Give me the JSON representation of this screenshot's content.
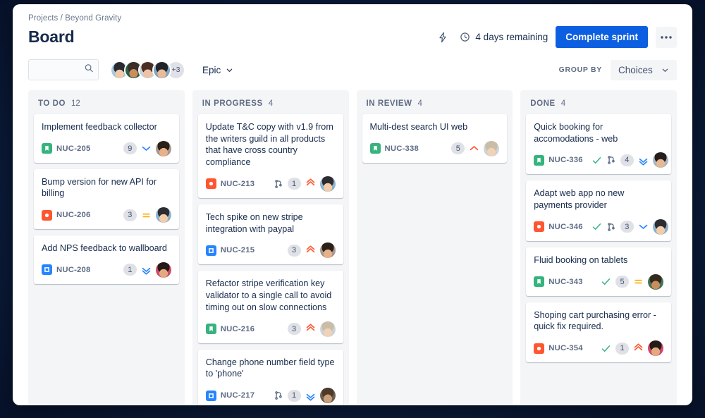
{
  "header": {
    "breadcrumb": "Projects / Beyond Gravity",
    "title": "Board",
    "lightning_icon": "lightning-icon",
    "clock_icon": "clock-icon",
    "days_remaining": "4 days remaining",
    "complete_sprint_label": "Complete sprint",
    "more_label": "•••"
  },
  "toolbar": {
    "search_placeholder": "",
    "search_value": "",
    "search_icon": "search-icon",
    "avatar_overflow": "+3",
    "avatar_count": 4,
    "epic_label": "Epic",
    "epic_chevron": "chevron-down-icon",
    "group_by_label": "GROUP BY",
    "group_by_value": "Choices",
    "group_by_chevron": "chevron-down-icon"
  },
  "colors": {
    "accent": "#0c5fe0",
    "story": "#36b37e",
    "bug": "#ff5630",
    "task": "#2684ff",
    "column_bg": "#f4f5f7",
    "text": "#172b4d",
    "subtle_text": "#5e6c84",
    "priority_high": "#ff5630",
    "priority_medium": "#ffab00",
    "priority_low": "#2684ff",
    "done": "#36b37e",
    "page_bg": "#0b1b3a"
  },
  "columns": [
    {
      "name": "TO DO",
      "count": "12",
      "cards": [
        {
          "title": "Implement feedback collector",
          "key": "NUC-205",
          "type": "story",
          "estimate": "9",
          "priority": "low",
          "branch": false,
          "done": false,
          "avatar": 5
        },
        {
          "title": "Bump version for new API for billing",
          "key": "NUC-206",
          "type": "bug",
          "estimate": "3",
          "priority": "medium",
          "branch": false,
          "done": false,
          "avatar": 0
        },
        {
          "title": "Add NPS feedback to wallboard",
          "key": "NUC-208",
          "type": "task",
          "estimate": "1",
          "priority": "lowest",
          "branch": false,
          "done": false,
          "avatar": 6
        }
      ]
    },
    {
      "name": "IN PROGRESS",
      "count": "4",
      "cards": [
        {
          "title": "Update T&C copy with v1.9 from the writers guild in all products that have cross country compliance",
          "key": "NUC-213",
          "type": "bug",
          "estimate": "1",
          "priority": "highest",
          "branch": true,
          "done": false,
          "avatar": 0
        },
        {
          "title": "Tech spike on new stripe integration with paypal",
          "key": "NUC-215",
          "type": "task",
          "estimate": "3",
          "priority": "highest",
          "branch": false,
          "done": false,
          "avatar": 5
        },
        {
          "title": "Refactor stripe verification key validator to a single call to avoid timing out on slow connections",
          "key": "NUC-216",
          "type": "story",
          "estimate": "3",
          "priority": "highest",
          "branch": false,
          "done": false,
          "avatar": 3
        },
        {
          "title": "Change phone number field type to 'phone'",
          "key": "NUC-217",
          "type": "task",
          "estimate": "1",
          "priority": "lowest",
          "branch": true,
          "done": false,
          "avatar": 4
        }
      ]
    },
    {
      "name": "IN REVIEW",
      "count": "4",
      "cards": [
        {
          "title": "Multi-dest search UI web",
          "key": "NUC-338",
          "type": "story",
          "estimate": "5",
          "priority": "high",
          "branch": false,
          "done": false,
          "avatar": 3
        }
      ]
    },
    {
      "name": "DONE",
      "count": "4",
      "cards": [
        {
          "title": "Quick booking for accomodations - web",
          "key": "NUC-336",
          "type": "story",
          "estimate": "4",
          "priority": "lowest",
          "branch": true,
          "done": true,
          "avatar": 2
        },
        {
          "title": "Adapt web app no new payments provider",
          "key": "NUC-346",
          "type": "bug",
          "estimate": "3",
          "priority": "low",
          "branch": true,
          "done": true,
          "avatar": 0
        },
        {
          "title": "Fluid booking on tablets",
          "key": "NUC-343",
          "type": "story",
          "estimate": "5",
          "priority": "medium",
          "branch": false,
          "done": true,
          "avatar": 1
        },
        {
          "title": "Shoping cart purchasing error - quick fix required.",
          "key": "NUC-354",
          "type": "bug",
          "estimate": "1",
          "priority": "highest",
          "branch": false,
          "done": true,
          "avatar": 6
        }
      ]
    }
  ]
}
